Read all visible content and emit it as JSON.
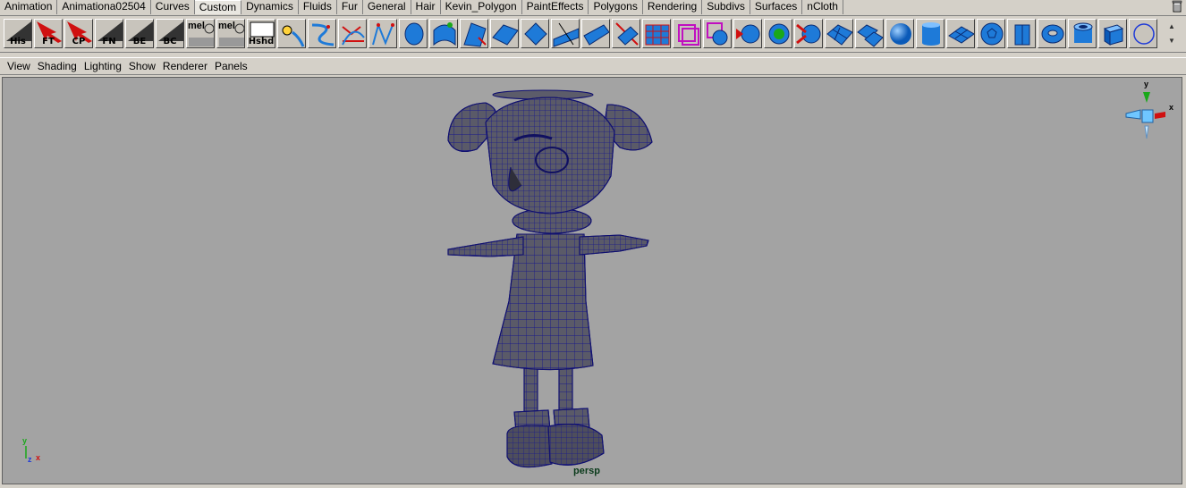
{
  "shelf_tabs": [
    "Animation",
    "Animationa02504",
    "Curves",
    "Custom",
    "Dynamics",
    "Fluids",
    "Fur",
    "General",
    "Hair",
    "Kevin_Polygon",
    "PaintEffects",
    "Polygons",
    "Rendering",
    "Subdivs",
    "Surfaces",
    "nCloth"
  ],
  "active_tab": "Custom",
  "shelf_labels": {
    "his": "His",
    "ft": "FT",
    "cp": "CP",
    "fn": "FN",
    "be": "BE",
    "bc": "BC",
    "mel1": "mel",
    "mel2": "mel",
    "hshd": "Hshd"
  },
  "panel_menus": [
    "View",
    "Shading",
    "Lighting",
    "Show",
    "Renderer",
    "Panels"
  ],
  "viewport": {
    "camera_label": "persp",
    "axis_y": "y",
    "axis_x": "x",
    "axis_z": "z"
  },
  "colors": {
    "viewport_bg": "#a3a3a3",
    "mesh_fill": "#5a5a68",
    "wire": "#101080",
    "shelf_blue": "#1e7ad8"
  },
  "icons": [
    "trash-icon",
    "history-icon",
    "wireframe-icon",
    "sphere-icon",
    "cylinder-icon",
    "cube-icon",
    "torus-icon",
    "circle-icon"
  ]
}
